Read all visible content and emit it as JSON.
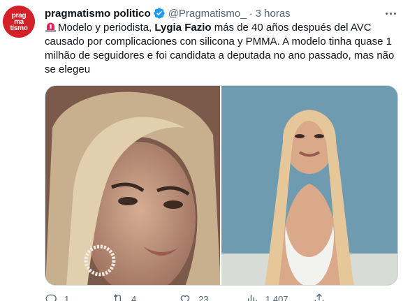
{
  "author": {
    "avatar_lines": [
      "prag",
      "ma",
      "tismo"
    ],
    "name": "pragmatismo politico",
    "handle": "@Pragmatismo_",
    "separator": "·",
    "time": "3 horas"
  },
  "tweet": {
    "text_part1": "Modelo y periodista, ",
    "text_bold": "Lygia Fazio",
    "text_part2": " más de 40 años después del AVC causado por complicaciones con silicona y PMMA. A modelo tinha quase 1 milhão de seguidores e foi candidata a deputada no ano passado, mas não se elegeu"
  },
  "media": {
    "left_image": "close-up-portrait-photo",
    "right_image": "beach-photo"
  },
  "actions": {
    "replies": "1",
    "retweets": "4",
    "likes": "23",
    "views": "1.407"
  },
  "colors": {
    "text": "#0f1419",
    "secondary": "#536471",
    "verified": "#1d9bf0",
    "avatar_bg": "#d42127"
  }
}
